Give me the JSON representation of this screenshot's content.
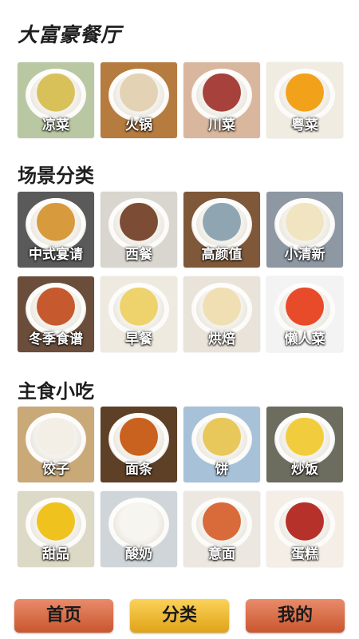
{
  "app": {
    "title": "大富豪餐厅"
  },
  "sections": [
    {
      "title": "",
      "items": [
        {
          "label": "凉菜",
          "icon": "cold-dish-photo",
          "bg": "#b9c8a3",
          "food": "#d9c15a"
        },
        {
          "label": "火锅",
          "icon": "hotpot-photo",
          "bg": "#b67b3f",
          "food": "#e3d2b4"
        },
        {
          "label": "川菜",
          "icon": "sichuan-dish-photo",
          "bg": "#d9b79e",
          "food": "#a6413b"
        },
        {
          "label": "粤菜",
          "icon": "cantonese-dish-photo",
          "bg": "#f0ece1",
          "food": "#f2a21a"
        }
      ]
    },
    {
      "title": "场景分类",
      "items": [
        {
          "label": "中式宴请",
          "icon": "chinese-banquet-photo",
          "bg": "#5a5a5a",
          "food": "#d79a3c"
        },
        {
          "label": "西餐",
          "icon": "western-food-photo",
          "bg": "#d8d6cf",
          "food": "#7c4d34"
        },
        {
          "label": "高颜值",
          "icon": "pretty-dish-photo",
          "bg": "#7e5838",
          "food": "#8fa6b2"
        },
        {
          "label": "小清新",
          "icon": "fresh-dish-photo",
          "bg": "#8e98a3",
          "food": "#f1e4c1"
        },
        {
          "label": "冬季食谱",
          "icon": "winter-recipe-photo",
          "bg": "#6a4e3b",
          "food": "#c65a2e"
        },
        {
          "label": "早餐",
          "icon": "breakfast-photo",
          "bg": "#eeeae0",
          "food": "#eed36d"
        },
        {
          "label": "烘焙",
          "icon": "baking-photo",
          "bg": "#e9e3da",
          "food": "#f1dfb4"
        },
        {
          "label": "懒人菜",
          "icon": "lazy-dish-photo",
          "bg": "#f3f3f3",
          "food": "#e84b2a"
        }
      ]
    },
    {
      "title": "主食小吃",
      "items": [
        {
          "label": "饺子",
          "icon": "dumplings-photo",
          "bg": "#caa978",
          "food": "#f3efe7"
        },
        {
          "label": "面条",
          "icon": "noodles-photo",
          "bg": "#5d4026",
          "food": "#c9621e"
        },
        {
          "label": "饼",
          "icon": "pancake-photo",
          "bg": "#a7c2d8",
          "food": "#e8c85a"
        },
        {
          "label": "炒饭",
          "icon": "fried-rice-photo",
          "bg": "#6c6c5f",
          "food": "#f1cd3e"
        },
        {
          "label": "甜品",
          "icon": "dessert-photo",
          "bg": "#dcd9c6",
          "food": "#f0c21d"
        },
        {
          "label": "酸奶",
          "icon": "yogurt-photo",
          "bg": "#cfd5d8",
          "food": "#f7f5f0"
        },
        {
          "label": "意面",
          "icon": "pasta-photo",
          "bg": "#ece8e1",
          "food": "#d96b3a"
        },
        {
          "label": "蛋糕",
          "icon": "cake-photo",
          "bg": "#f4eee6",
          "food": "#b7312b"
        }
      ]
    }
  ],
  "footer_note": "",
  "bottom_nav": [
    {
      "label": "首页",
      "name": "nav-home-button"
    },
    {
      "label": "分类",
      "name": "nav-category-button"
    },
    {
      "label": "我的",
      "name": "nav-mine-button"
    }
  ]
}
